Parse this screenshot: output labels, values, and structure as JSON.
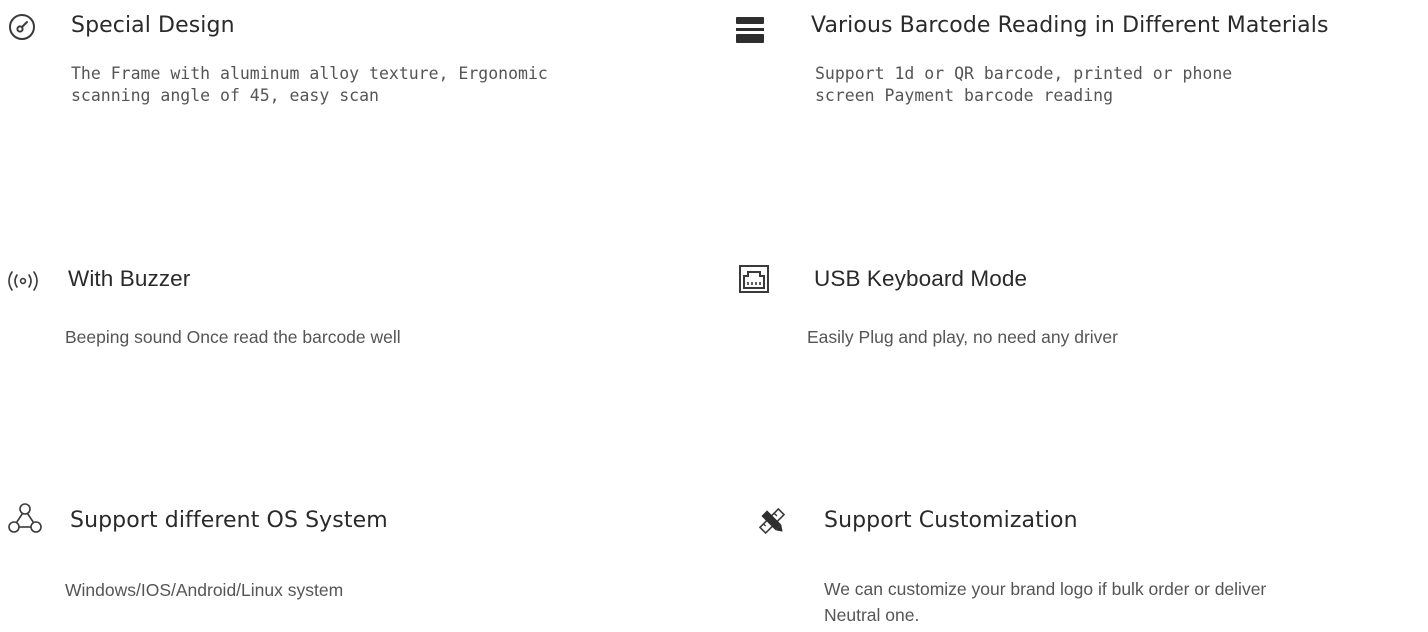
{
  "features": [
    {
      "icon": "speedometer-icon",
      "title": "Special Design",
      "description": "The Frame with aluminum alloy texture, Ergonomic scanning angle of 45, easy scan"
    },
    {
      "icon": "scanner-icon",
      "title": "Various Barcode Reading in Different Materials",
      "description": "Support 1d or QR barcode, printed or phone screen Payment barcode reading"
    },
    {
      "icon": "buzzer-icon",
      "title": "With Buzzer",
      "description": "Beeping sound Once read the barcode well"
    },
    {
      "icon": "usb-port-icon",
      "title": "USB Keyboard Mode",
      "description": "Easily Plug and play, no need any driver"
    },
    {
      "icon": "network-nodes-icon",
      "title": "Support different OS System",
      "description": "Windows/IOS/Android/Linux system"
    },
    {
      "icon": "pen-ruler-icon",
      "title": "Support Customization",
      "description": "We can customize your brand logo if bulk order or deliver Neutral one."
    }
  ],
  "colors": {
    "text": "#2a2a2a",
    "muted": "#555555",
    "icon": "#3a3a3a"
  }
}
